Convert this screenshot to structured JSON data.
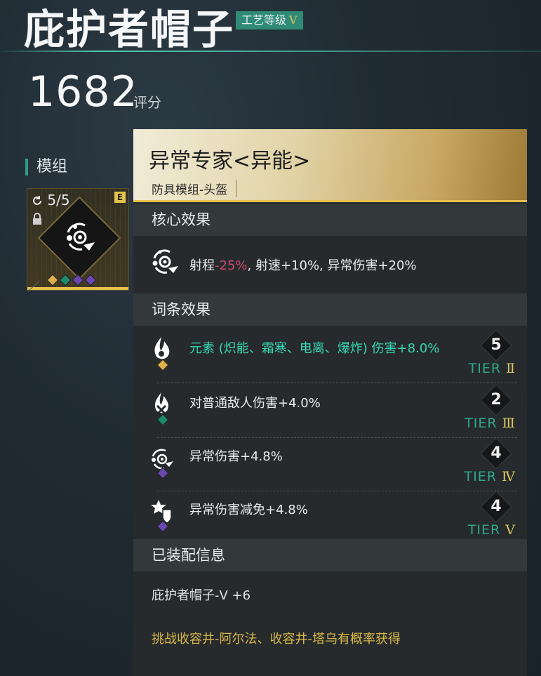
{
  "item": {
    "name": "庇护者帽子",
    "craft_label": "工艺等级",
    "craft_tier": "V",
    "score": "1682",
    "score_unit": "评分"
  },
  "modules": {
    "label": "模组",
    "card": {
      "count": "5/5",
      "rank": "E",
      "gems": [
        "#e0b04a",
        "#1f8a6a",
        "#6a48b0",
        "#6a48b0"
      ]
    }
  },
  "panel": {
    "title": "异常专家<异能>",
    "subtitle": "防具模组-头盔",
    "core_header": "核心效果",
    "core_effect": {
      "prefix": "射程",
      "negative": "-25%",
      "rest": ", 射速+10%, 异常伤害+20%"
    },
    "affix_header": "词条效果",
    "affixes": [
      {
        "text": "元素 (炽能、霜寒、电离、爆炸) 伤害+8.0%",
        "level": "5",
        "tier_label": "TIER",
        "tier_roman": "Ⅱ",
        "gem": "#e0b04a",
        "highlight": true
      },
      {
        "text": "对普通敌人伤害+4.0%",
        "level": "2",
        "tier_label": "TIER",
        "tier_roman": "Ⅲ",
        "gem": "#1f8a6a",
        "highlight": false
      },
      {
        "text": "异常伤害+4.8%",
        "level": "4",
        "tier_label": "TIER",
        "tier_roman": "Ⅳ",
        "gem": "#6a48b0",
        "highlight": false
      },
      {
        "text": "异常伤害减免+4.8%",
        "level": "4",
        "tier_label": "TIER",
        "tier_roman": "Ⅴ",
        "gem": "#6a48b0",
        "highlight": false
      }
    ],
    "equip_header": "已装配信息",
    "equip_name": "庇护者帽子-Ⅴ +6",
    "source": "挑战收容井-阿尔法、收容井-塔乌有概率获得"
  },
  "colors": {
    "accent_teal": "#2f9c83",
    "gold": "#e6c14a",
    "negative": "#d14a6a"
  }
}
